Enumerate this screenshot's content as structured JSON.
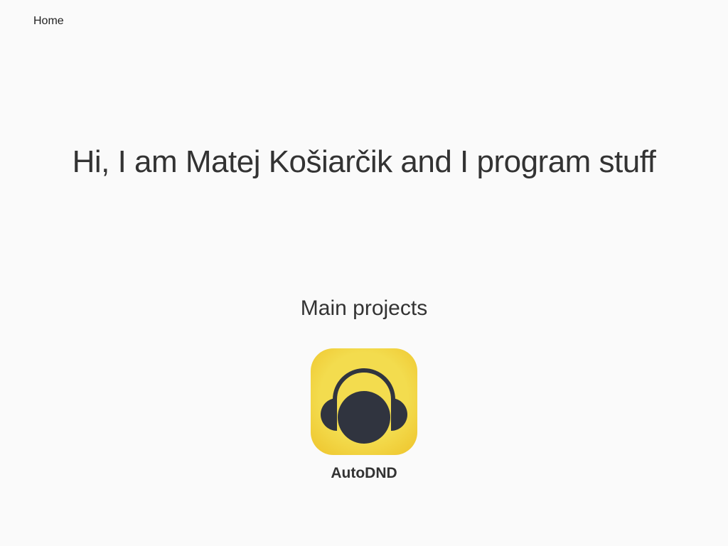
{
  "nav": {
    "home_label": "Home"
  },
  "hero": {
    "title": "Hi, I am Matej Košiarčik and I program stuff"
  },
  "projects": {
    "heading": "Main projects",
    "items": [
      {
        "name": "AutoDND",
        "icon": "headphones-icon",
        "icon_bg": "#f2d43f",
        "icon_fg": "#30343f"
      }
    ]
  }
}
